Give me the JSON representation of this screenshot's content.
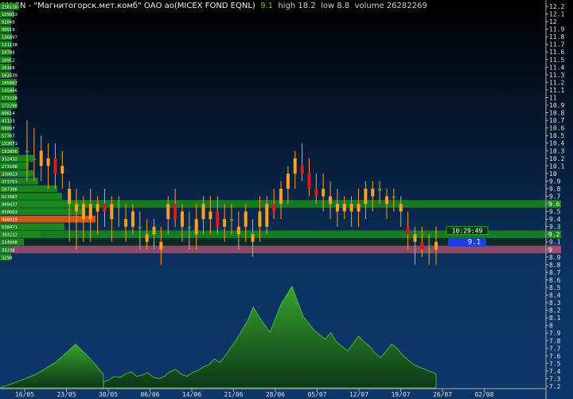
{
  "header": {
    "ticker": "MAGN",
    "separator": " - ",
    "name": "\"Магнитогорск.мет.комб\" ОАО ао(MICEX FOND EQNL)",
    "last": "9.1",
    "high_label": "high 18.2",
    "low_label": "low 8.8",
    "volume_label": "volume 26282269"
  },
  "colors": {
    "up": "#ffa020",
    "down": "#e01818",
    "flat": "#20b030",
    "volume_fill": "#2c7a20",
    "profile": "#1a8a1a",
    "profile_max": "#d85a10",
    "band_green": "#1a8a1a",
    "band_pink": "#a05070",
    "cursor_box": "#1a3fe0"
  },
  "price_axis": {
    "labels": [
      "12.2",
      "12.1",
      "12",
      "11.9",
      "11.8",
      "11.7",
      "11.6",
      "11.5",
      "11.4",
      "11.3",
      "11.2",
      "11.1",
      "11",
      "10.9",
      "10.8",
      "10.7",
      "10.6",
      "10.5",
      "10.4",
      "10.3",
      "10.2",
      "10.1",
      "10",
      "9.9",
      "9.8",
      "9.7",
      "9.6",
      "9.5",
      "9.4",
      "9.3",
      "9.2",
      "9.1",
      "9",
      "8.9",
      "8.8",
      "8.7",
      "8.6",
      "8.5",
      "8.4",
      "8.3",
      "8.2",
      "8.1",
      "8",
      "7.9",
      "7.8",
      "7.7",
      "7.6",
      "7.5",
      "7.4",
      "7.3",
      "7.2"
    ]
  },
  "date_axis": {
    "labels": [
      "16/05",
      "23/05",
      "30/05",
      "06/06",
      "14/06",
      "21/06",
      "28/06",
      "05/07",
      "12/07",
      "19/07",
      "26/07",
      "02/08"
    ]
  },
  "band_labels": {
    "upper": "9.6",
    "middle": "9.2",
    "lower": "9"
  },
  "cursor": {
    "time": "10:29:49",
    "price": "9.1"
  },
  "chart_data": {
    "type": "candlestick",
    "y_range": [
      7.2,
      12.2
    ],
    "volume_profile": [
      {
        "price": 12.2,
        "volume": "216110",
        "w": 8
      },
      {
        "price": 12.1,
        "volume": "159913",
        "w": 6
      },
      {
        "price": 12.0,
        "volume": "92049",
        "w": 4
      },
      {
        "price": 11.9,
        "volume": "90519",
        "w": 4
      },
      {
        "price": 11.8,
        "volume": "136897",
        "w": 5
      },
      {
        "price": 11.7,
        "volume": "111138",
        "w": 5
      },
      {
        "price": 11.6,
        "volume": "19788",
        "w": 2
      },
      {
        "price": 11.5,
        "volume": "20952",
        "w": 2
      },
      {
        "price": 11.4,
        "volume": "26168",
        "w": 2
      },
      {
        "price": 11.3,
        "volume": "102439",
        "w": 4
      },
      {
        "price": 11.2,
        "volume": "185867",
        "w": 7
      },
      {
        "price": 11.1,
        "volume": "145806",
        "w": 6
      },
      {
        "price": 11.0,
        "volume": "173220",
        "w": 7
      },
      {
        "price": 10.9,
        "volume": "172290",
        "w": 7
      },
      {
        "price": 10.8,
        "volume": "60614",
        "w": 3
      },
      {
        "price": 10.7,
        "volume": "41133",
        "w": 2
      },
      {
        "price": 10.6,
        "volume": "69097",
        "w": 3
      },
      {
        "price": 10.5,
        "volume": "57707",
        "w": 3
      },
      {
        "price": 10.4,
        "volume": "153071",
        "w": 6
      },
      {
        "price": 10.3,
        "volume": "193856",
        "w": 8
      },
      {
        "price": 10.2,
        "volume": "332432",
        "w": 14
      },
      {
        "price": 10.1,
        "volume": "273108",
        "w": 12
      },
      {
        "price": 10.0,
        "volume": "330023",
        "w": 14
      },
      {
        "price": 9.9,
        "volume": "373751",
        "w": 16
      },
      {
        "price": 9.8,
        "volume": "587306",
        "w": 24
      },
      {
        "price": 9.7,
        "volume": "621907",
        "w": 26
      },
      {
        "price": 9.6,
        "volume": "909437",
        "w": 37
      },
      {
        "price": 9.5,
        "volume": "850663",
        "w": 35
      },
      {
        "price": 9.4,
        "volume": "960919",
        "w": 40,
        "max": true
      },
      {
        "price": 9.3,
        "volume": "638471",
        "w": 27
      },
      {
        "price": 9.2,
        "volume": "393212",
        "w": 17
      },
      {
        "price": 9.1,
        "volume": "224608",
        "w": 10
      },
      {
        "price": 9.0,
        "volume": "33238",
        "w": 2
      },
      {
        "price": 8.9,
        "volume": "3290",
        "w": 1
      }
    ],
    "candles": [
      {
        "d": "25/05",
        "o": 10.3,
        "h": 10.7,
        "l": 9.9,
        "c": 10.3
      },
      {
        "d": "26/05",
        "o": 10.2,
        "h": 10.6,
        "l": 9.9,
        "c": 10.2
      },
      {
        "d": "27/05",
        "o": 10.1,
        "h": 10.5,
        "l": 9.9,
        "c": 10.3
      },
      {
        "d": "28/05",
        "o": 10.1,
        "h": 10.4,
        "l": 9.8,
        "c": 10.2
      },
      {
        "d": "29/05",
        "o": 10.2,
        "h": 10.4,
        "l": 9.8,
        "c": 10.0
      },
      {
        "d": "30/05",
        "o": 10.0,
        "h": 10.3,
        "l": 9.8,
        "c": 10.1
      },
      {
        "d": "31/05",
        "o": 9.6,
        "h": 9.9,
        "l": 9.1,
        "c": 9.8
      },
      {
        "d": "01/06",
        "o": 9.5,
        "h": 9.8,
        "l": 9.0,
        "c": 9.6
      },
      {
        "d": "02/06",
        "o": 9.4,
        "h": 9.7,
        "l": 9.1,
        "c": 9.6
      },
      {
        "d": "03/06",
        "o": 9.4,
        "h": 9.8,
        "l": 9.1,
        "c": 9.6
      },
      {
        "d": "04/06",
        "o": 9.5,
        "h": 9.7,
        "l": 9.2,
        "c": 9.6
      },
      {
        "d": "05/06",
        "o": 9.6,
        "h": 9.8,
        "l": 9.3,
        "c": 9.5
      },
      {
        "d": "06/06",
        "o": 9.4,
        "h": 9.7,
        "l": 9.1,
        "c": 9.6
      },
      {
        "d": "07/06",
        "o": 9.6,
        "h": 9.7,
        "l": 9.3,
        "c": 9.6
      },
      {
        "d": "08/06",
        "o": 9.3,
        "h": 9.6,
        "l": 9.1,
        "c": 9.4
      },
      {
        "d": "09/06",
        "o": 9.3,
        "h": 9.6,
        "l": 9.2,
        "c": 9.5
      },
      {
        "d": "10/06",
        "o": 9.3,
        "h": 9.5,
        "l": 9.0,
        "c": 9.3
      },
      {
        "d": "11/06",
        "o": 9.1,
        "h": 9.4,
        "l": 9.0,
        "c": 9.2
      },
      {
        "d": "12/06",
        "o": 9.2,
        "h": 9.4,
        "l": 9.0,
        "c": 9.3
      },
      {
        "d": "13/06",
        "o": 9.0,
        "h": 9.3,
        "l": 8.8,
        "c": 9.1
      },
      {
        "d": "14/06",
        "o": 9.4,
        "h": 9.7,
        "l": 9.2,
        "c": 9.6
      },
      {
        "d": "15/06",
        "o": 9.6,
        "h": 9.8,
        "l": 9.3,
        "c": 9.4
      },
      {
        "d": "16/06",
        "o": 9.3,
        "h": 9.6,
        "l": 9.1,
        "c": 9.5
      },
      {
        "d": "17/06",
        "o": 9.3,
        "h": 9.5,
        "l": 9.0,
        "c": 9.3
      },
      {
        "d": "18/06",
        "o": 9.2,
        "h": 9.6,
        "l": 9.0,
        "c": 9.4
      },
      {
        "d": "19/06",
        "o": 9.4,
        "h": 9.7,
        "l": 9.2,
        "c": 9.6
      },
      {
        "d": "20/06",
        "o": 9.4,
        "h": 9.7,
        "l": 9.2,
        "c": 9.5
      },
      {
        "d": "21/06",
        "o": 9.5,
        "h": 9.7,
        "l": 9.2,
        "c": 9.3
      },
      {
        "d": "22/06",
        "o": 9.3,
        "h": 9.6,
        "l": 9.1,
        "c": 9.4
      },
      {
        "d": "23/06",
        "o": 9.4,
        "h": 9.6,
        "l": 9.2,
        "c": 9.4
      },
      {
        "d": "24/06",
        "o": 9.2,
        "h": 9.5,
        "l": 9.0,
        "c": 9.3
      },
      {
        "d": "25/06",
        "o": 9.3,
        "h": 9.6,
        "l": 9.1,
        "c": 9.5
      },
      {
        "d": "26/06",
        "o": 9.1,
        "h": 9.4,
        "l": 8.9,
        "c": 9.2
      },
      {
        "d": "27/06",
        "o": 9.3,
        "h": 9.7,
        "l": 9.1,
        "c": 9.5
      },
      {
        "d": "28/06",
        "o": 9.3,
        "h": 9.7,
        "l": 9.2,
        "c": 9.6
      },
      {
        "d": "29/06",
        "o": 9.6,
        "h": 9.8,
        "l": 9.4,
        "c": 9.5
      },
      {
        "d": "30/06",
        "o": 9.6,
        "h": 9.9,
        "l": 9.4,
        "c": 9.8
      },
      {
        "d": "01/07",
        "o": 9.8,
        "h": 10.1,
        "l": 9.6,
        "c": 10.0
      },
      {
        "d": "02/07",
        "o": 10.0,
        "h": 10.3,
        "l": 9.8,
        "c": 10.2
      },
      {
        "d": "03/07",
        "o": 10.1,
        "h": 10.4,
        "l": 9.9,
        "c": 10.0
      },
      {
        "d": "04/07",
        "o": 10.0,
        "h": 10.2,
        "l": 9.7,
        "c": 9.8
      },
      {
        "d": "05/07",
        "o": 9.8,
        "h": 10.0,
        "l": 9.6,
        "c": 9.7
      },
      {
        "d": "06/07",
        "o": 9.7,
        "h": 10.0,
        "l": 9.5,
        "c": 9.8
      },
      {
        "d": "07/07",
        "o": 9.6,
        "h": 9.9,
        "l": 9.4,
        "c": 9.7
      },
      {
        "d": "08/07",
        "o": 9.5,
        "h": 9.8,
        "l": 9.3,
        "c": 9.6
      },
      {
        "d": "09/07",
        "o": 9.5,
        "h": 9.7,
        "l": 9.4,
        "c": 9.6
      },
      {
        "d": "10/07",
        "o": 9.5,
        "h": 9.7,
        "l": 9.3,
        "c": 9.6
      },
      {
        "d": "11/07",
        "o": 9.5,
        "h": 9.8,
        "l": 9.3,
        "c": 9.6
      },
      {
        "d": "12/07",
        "o": 9.6,
        "h": 9.9,
        "l": 9.4,
        "c": 9.8
      },
      {
        "d": "13/07",
        "o": 9.7,
        "h": 9.9,
        "l": 9.5,
        "c": 9.8
      },
      {
        "d": "14/07",
        "o": 9.8,
        "h": 9.9,
        "l": 9.6,
        "c": 9.8
      },
      {
        "d": "15/07",
        "o": 9.6,
        "h": 9.8,
        "l": 9.4,
        "c": 9.7
      },
      {
        "d": "16/07",
        "o": 9.7,
        "h": 9.8,
        "l": 9.5,
        "c": 9.7
      },
      {
        "d": "17/07",
        "o": 9.5,
        "h": 9.7,
        "l": 9.3,
        "c": 9.6
      },
      {
        "d": "18/07",
        "o": 9.3,
        "h": 9.5,
        "l": 9.0,
        "c": 9.2
      },
      {
        "d": "19/07",
        "o": 9.1,
        "h": 9.3,
        "l": 8.8,
        "c": 9.2
      },
      {
        "d": "20/07",
        "o": 9.1,
        "h": 9.3,
        "l": 8.9,
        "c": 9.0
      },
      {
        "d": "21/07",
        "o": 9.0,
        "h": 9.2,
        "l": 8.8,
        "c": 9.0
      },
      {
        "d": "22/07",
        "o": 9.0,
        "h": 9.3,
        "l": 8.8,
        "c": 9.1
      }
    ],
    "volume": [
      5,
      7,
      10,
      9,
      12,
      14,
      10,
      11,
      13,
      9,
      8,
      10,
      14,
      16,
      12,
      10,
      13,
      15,
      18,
      20,
      25,
      22,
      28,
      35,
      42,
      50,
      58,
      70,
      62,
      55,
      48,
      60,
      72,
      80,
      88,
      75,
      62,
      56,
      50,
      46,
      42,
      48,
      40,
      36,
      32,
      38,
      45,
      40,
      36,
      30,
      26,
      32,
      38,
      34,
      28,
      24,
      20,
      18,
      16,
      14,
      12
    ]
  }
}
